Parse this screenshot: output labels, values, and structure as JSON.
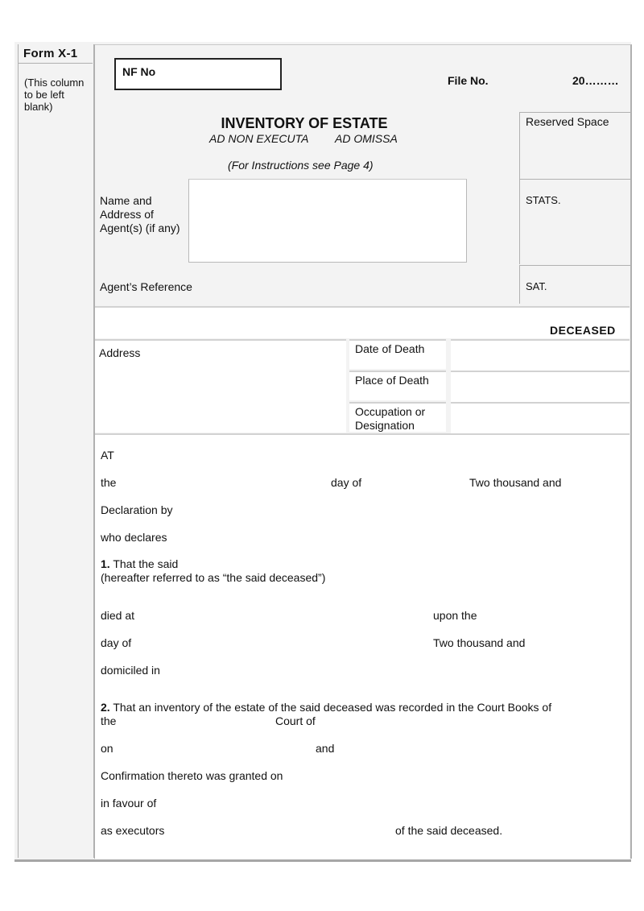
{
  "form": {
    "form_id": "Form X-1",
    "left_column_note": "(This column to be left blank)",
    "nf_label": "NF No",
    "file_no_label": "File No.",
    "file_year": "20………",
    "title": "INVENTORY OF ESTATE",
    "subtitle_left": "AD NON EXECUTA",
    "subtitle_right": "AD OMISSA",
    "instructions": "(For Instructions see Page 4)",
    "reserved_space": "Reserved Space",
    "stats": "STATS.",
    "sat": "SAT.",
    "agent_label": "Name and Address of Agent(s) (if any)",
    "agent_reference": "Agent’s Reference",
    "deceased": "DECEASED",
    "address_label": "Address",
    "fields": [
      {
        "label": "Date of Death",
        "value": ""
      },
      {
        "label": "Place of Death",
        "value": ""
      },
      {
        "label": "Occupation or Designation",
        "value": ""
      }
    ]
  },
  "declaration": {
    "at": "AT",
    "the": "the",
    "day_of": "day of",
    "two_thousand_and": "Two thousand and",
    "declaration_by": "Declaration by",
    "who_declares": "who declares",
    "p1_num": "1.",
    "p1_text": "That the said",
    "p1_sub": "(hereafter referred to as “the said deceased”)",
    "died_at": "died at",
    "upon_the": "upon the",
    "day_of_2": "day of",
    "two_thousand_and_2": "Two thousand and",
    "domiciled_in": "domiciled in",
    "p2_num": "2.",
    "p2_text": "That an inventory of the estate of the said deceased was recorded in the Court Books of",
    "p2_the": "the",
    "p2_court_of": "Court of",
    "on": "on",
    "and": "and",
    "confirmation": "Confirmation thereto was granted on",
    "in_favour_of": "in favour of",
    "as_executors": "as executors",
    "of_said_deceased": "of the said deceased."
  }
}
